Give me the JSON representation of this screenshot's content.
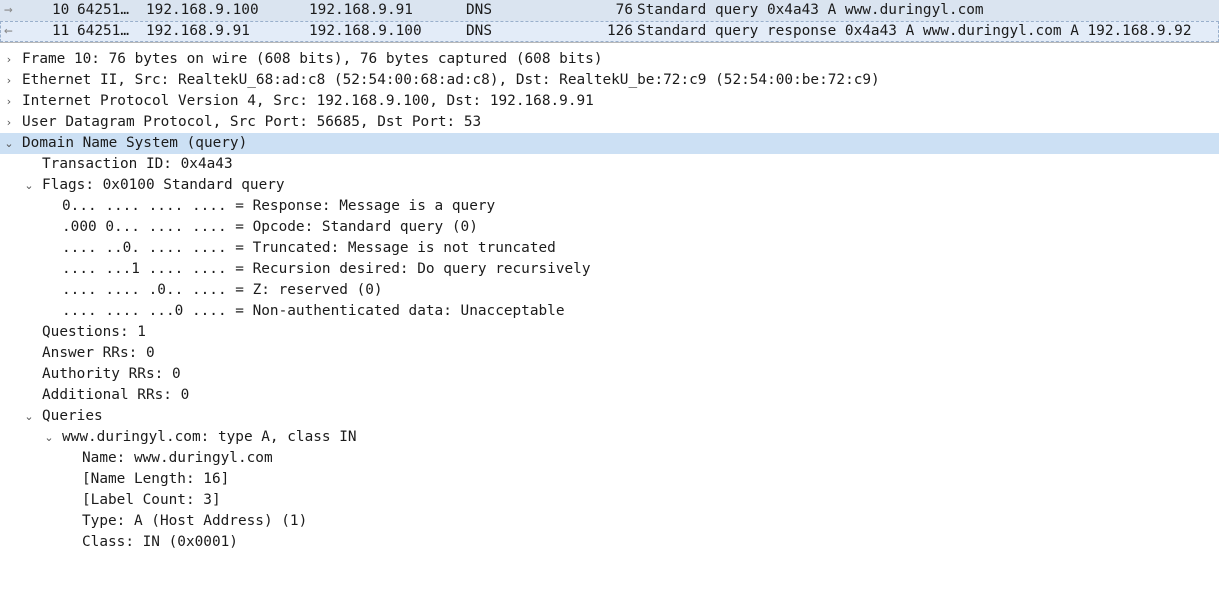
{
  "packet_list": {
    "rows": [
      {
        "no": "10",
        "time": "64251…",
        "src": "192.168.9.100",
        "dst": "192.168.9.91",
        "proto": "DNS",
        "len": "76",
        "info": "Standard query 0x4a43 A www.duringyl.com"
      },
      {
        "no": "11",
        "time": "64251…",
        "src": "192.168.9.91",
        "dst": "192.168.9.100",
        "proto": "DNS",
        "len": "126",
        "info": "Standard query response 0x4a43 A www.duringyl.com A 192.168.9.92"
      }
    ]
  },
  "icons": {
    "request_arrow": "→",
    "response_arrow": "←",
    "collapsed": "›",
    "expanded": "⌄"
  },
  "detail_tree": {
    "frame": "Frame 10: 76 bytes on wire (608 bits), 76 bytes captured (608 bits)",
    "ethernet": "Ethernet II, Src: RealtekU_68:ad:c8 (52:54:00:68:ad:c8), Dst: RealtekU_be:72:c9 (52:54:00:be:72:c9)",
    "ip": "Internet Protocol Version 4, Src: 192.168.9.100, Dst: 192.168.9.91",
    "udp": "User Datagram Protocol, Src Port: 56685, Dst Port: 53",
    "dns": {
      "label": "Domain Name System (query)",
      "transaction_id": "Transaction ID: 0x4a43",
      "flags": {
        "label": "Flags: 0x0100 Standard query",
        "items": [
          "0... .... .... .... = Response: Message is a query",
          ".000 0... .... .... = Opcode: Standard query (0)",
          ".... ..0. .... .... = Truncated: Message is not truncated",
          ".... ...1 .... .... = Recursion desired: Do query recursively",
          ".... .... .0.. .... = Z: reserved (0)",
          ".... .... ...0 .... = Non-authenticated data: Unacceptable"
        ]
      },
      "questions": "Questions: 1",
      "answer_rrs": "Answer RRs: 0",
      "authority_rrs": "Authority RRs: 0",
      "additional_rrs": "Additional RRs: 0",
      "queries": {
        "label": "Queries",
        "entry": {
          "label": "www.duringyl.com: type A, class IN",
          "fields": [
            "Name: www.duringyl.com",
            "[Name Length: 16]",
            "[Label Count: 3]",
            "Type: A (Host Address) (1)",
            "Class: IN (0x0001)"
          ]
        }
      }
    }
  }
}
